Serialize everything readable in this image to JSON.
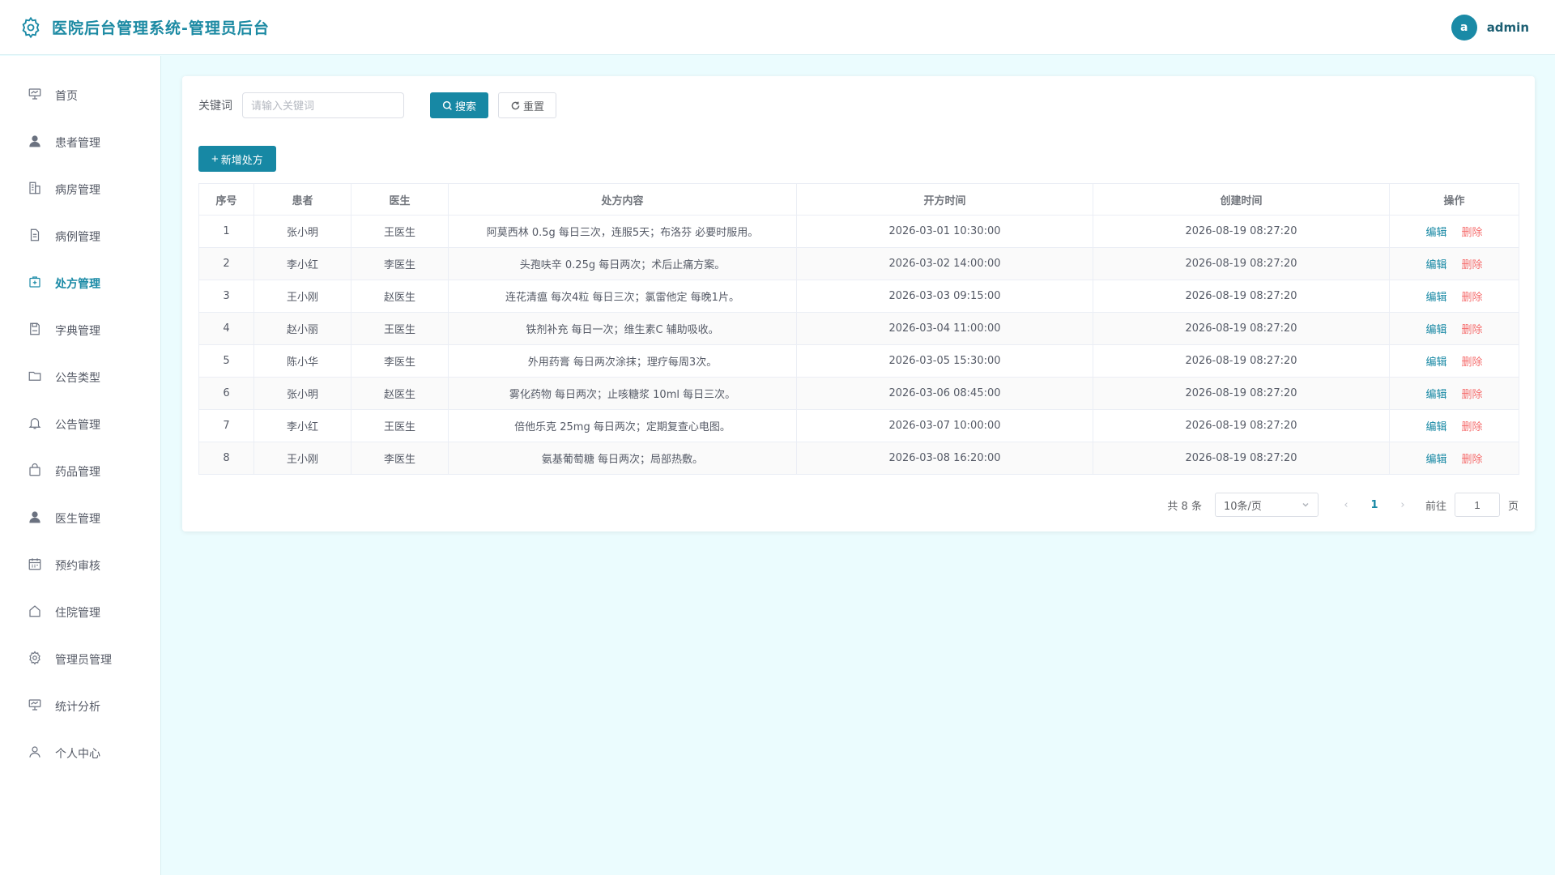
{
  "header": {
    "title": "医院后台管理系统-管理员后台",
    "avatar_letter": "a",
    "username": "admin"
  },
  "sidebar": {
    "items": [
      {
        "label": "首页",
        "icon": "presentation-icon"
      },
      {
        "label": "患者管理",
        "icon": "user-icon"
      },
      {
        "label": "病房管理",
        "icon": "building-icon"
      },
      {
        "label": "病例管理",
        "icon": "document-icon"
      },
      {
        "label": "处方管理",
        "icon": "medical-kit-icon",
        "active": true
      },
      {
        "label": "字典管理",
        "icon": "save-icon"
      },
      {
        "label": "公告类型",
        "icon": "folder-icon"
      },
      {
        "label": "公告管理",
        "icon": "bell-icon"
      },
      {
        "label": "药品管理",
        "icon": "bag-icon"
      },
      {
        "label": "医生管理",
        "icon": "user-icon"
      },
      {
        "label": "预约审核",
        "icon": "calendar-icon"
      },
      {
        "label": "住院管理",
        "icon": "house-icon"
      },
      {
        "label": "管理员管理",
        "icon": "gear-icon"
      },
      {
        "label": "统计分析",
        "icon": "presentation-icon"
      },
      {
        "label": "个人中心",
        "icon": "user-outline-icon"
      }
    ]
  },
  "search": {
    "label": "关键词",
    "placeholder": "请输入关键词",
    "search_button": "搜索",
    "reset_button": "重置"
  },
  "actions": {
    "add_button": "新增处方"
  },
  "table": {
    "headers": [
      "序号",
      "患者",
      "医生",
      "处方内容",
      "开方时间",
      "创建时间",
      "操作"
    ],
    "edit_label": "编辑",
    "delete_label": "删除",
    "rows": [
      [
        "1",
        "张小明",
        "王医生",
        "阿莫西林 0.5g 每日三次，连服5天；布洛芬 必要时服用。",
        "2026-03-01 10:30:00",
        "2026-08-19 08:27:20"
      ],
      [
        "2",
        "李小红",
        "李医生",
        "头孢呋辛 0.25g 每日两次；术后止痛方案。",
        "2026-03-02 14:00:00",
        "2026-08-19 08:27:20"
      ],
      [
        "3",
        "王小刚",
        "赵医生",
        "连花清瘟 每次4粒 每日三次；氯雷他定 每晚1片。",
        "2026-03-03 09:15:00",
        "2026-08-19 08:27:20"
      ],
      [
        "4",
        "赵小丽",
        "王医生",
        "铁剂补充 每日一次；维生素C 辅助吸收。",
        "2026-03-04 11:00:00",
        "2026-08-19 08:27:20"
      ],
      [
        "5",
        "陈小华",
        "李医生",
        "外用药膏 每日两次涂抹；理疗每周3次。",
        "2026-03-05 15:30:00",
        "2026-08-19 08:27:20"
      ],
      [
        "6",
        "张小明",
        "赵医生",
        "雾化药物 每日两次；止咳糖浆 10ml 每日三次。",
        "2026-03-06 08:45:00",
        "2026-08-19 08:27:20"
      ],
      [
        "7",
        "李小红",
        "王医生",
        "倍他乐克 25mg 每日两次；定期复查心电图。",
        "2026-03-07 10:00:00",
        "2026-08-19 08:27:20"
      ],
      [
        "8",
        "王小刚",
        "李医生",
        "氨基葡萄糖 每日两次；局部热敷。",
        "2026-03-08 16:20:00",
        "2026-08-19 08:27:20"
      ]
    ]
  },
  "pagination": {
    "total": "共 8 条",
    "page_size": "10条/页",
    "current_page": "1",
    "goto_label": "前往",
    "goto_value": "1",
    "page_unit": "页"
  },
  "colors": {
    "accent": "#1788a4",
    "danger": "#f56c6c",
    "background": "#ebfcfe"
  }
}
